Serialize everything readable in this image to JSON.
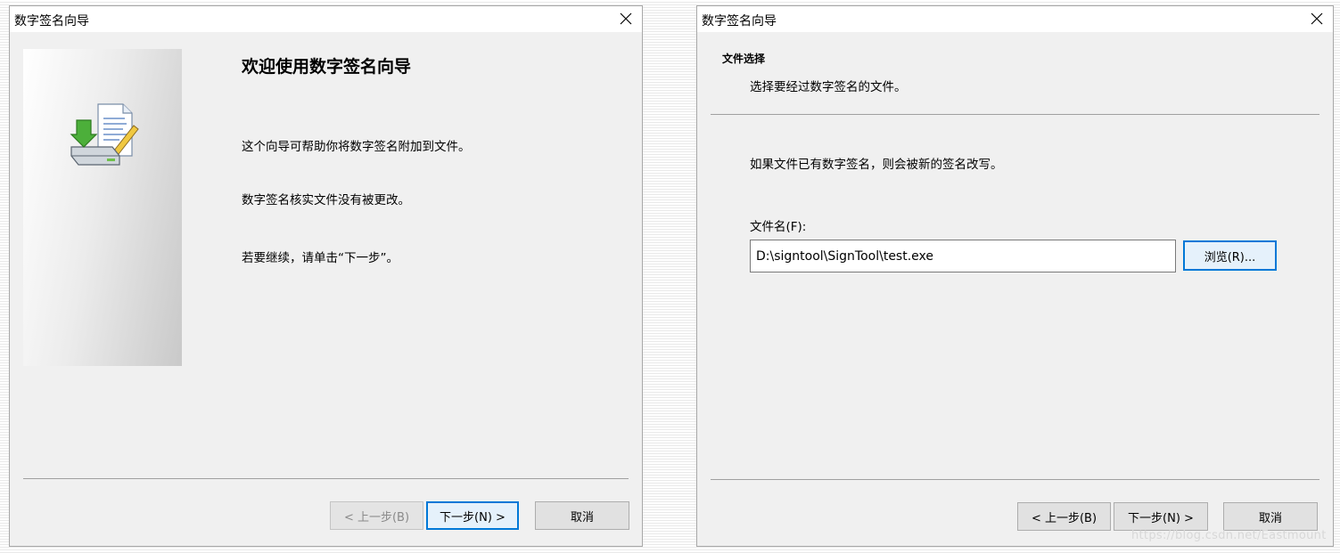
{
  "dialog1": {
    "title": "数字签名向导",
    "heading": "欢迎使用数字签名向导",
    "paragraphs": [
      "这个向导可帮助你将数字签名附加到文件。",
      "数字签名核实文件没有被更改。",
      "若要继续，请单击“下一步”。"
    ],
    "buttons": {
      "back": "< 上一步(B)",
      "next": "下一步(N) >",
      "cancel": "取消"
    }
  },
  "dialog2": {
    "title": "数字签名向导",
    "section_title": "文件选择",
    "section_subtitle": "选择要经过数字签名的文件。",
    "info": "如果文件已有数字签名，则会被新的签名改写。",
    "filename_label": "文件名(F):",
    "filename_value": "D:\\signtool\\SignTool\\test.exe",
    "browse_label": "浏览(R)...",
    "buttons": {
      "back": "< 上一步(B)",
      "next": "下一步(N) >",
      "cancel": "取消"
    }
  },
  "watermark": "https://blog.csdn.net/Eastmount",
  "icons": {
    "close": "close-icon",
    "wizard": "digital-signature-wizard-icon"
  },
  "colors": {
    "focus": "#0078d7",
    "dialog_bg": "#f0f0f0"
  }
}
